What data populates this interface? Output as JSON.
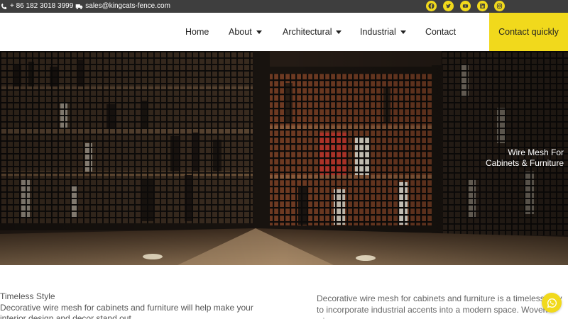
{
  "topbar": {
    "phone": "+ 86 182 3018 3999",
    "email": "sales@kingcats-fence.com",
    "social": [
      "facebook-icon",
      "twitter-icon",
      "youtube-icon",
      "linkedin-icon",
      "instagram-icon"
    ]
  },
  "nav": {
    "home": "Home",
    "about": "About",
    "architectural": "Architectural",
    "industrial": "Industrial",
    "contact": "Contact",
    "cta": "Contact quickly"
  },
  "hero": {
    "caption_line1": "Wire Mesh For",
    "caption_line2": "Cabinets & Furniture"
  },
  "content": {
    "left_title": "Timeless Style",
    "left_text": "Decorative wire mesh for cabinets and furniture will help make your interior design and decor stand out",
    "right_text": "Decorative wire mesh for cabinets and furniture is a timeless way to incorporate industrial accents into a modern space. Woven wire can"
  },
  "colors": {
    "accent": "#f1d91c",
    "topbar": "#3e3e3e"
  }
}
